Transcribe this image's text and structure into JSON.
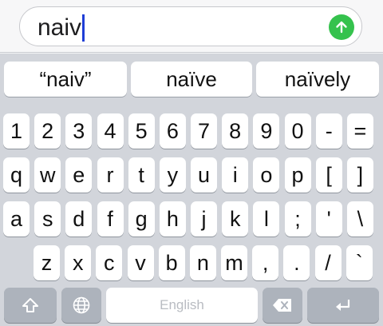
{
  "input": {
    "value": "naiv"
  },
  "suggestions": [
    "“naiv”",
    "naïve",
    "naïvely"
  ],
  "rows": [
    [
      "1",
      "2",
      "3",
      "4",
      "5",
      "6",
      "7",
      "8",
      "9",
      "0",
      "-",
      "="
    ],
    [
      "q",
      "w",
      "e",
      "r",
      "t",
      "y",
      "u",
      "i",
      "o",
      "p",
      "[",
      "]"
    ],
    [
      "a",
      "s",
      "d",
      "f",
      "g",
      "h",
      "j",
      "k",
      "l",
      ";",
      "'",
      "\\"
    ],
    [
      "z",
      "x",
      "c",
      "v",
      "b",
      "n",
      "m",
      ",",
      ".",
      "/",
      "`"
    ]
  ],
  "bottom": {
    "space_label": "English"
  },
  "colors": {
    "send_button": "#35c24d",
    "caret": "#1f3ed6",
    "keyboard_bg": "#d2d5db",
    "function_key": "#adb3bc"
  },
  "icons": {
    "send": "arrow-up-icon",
    "shift": "shift-icon",
    "globe": "globe-icon",
    "delete": "backspace-icon",
    "return": "return-icon"
  }
}
